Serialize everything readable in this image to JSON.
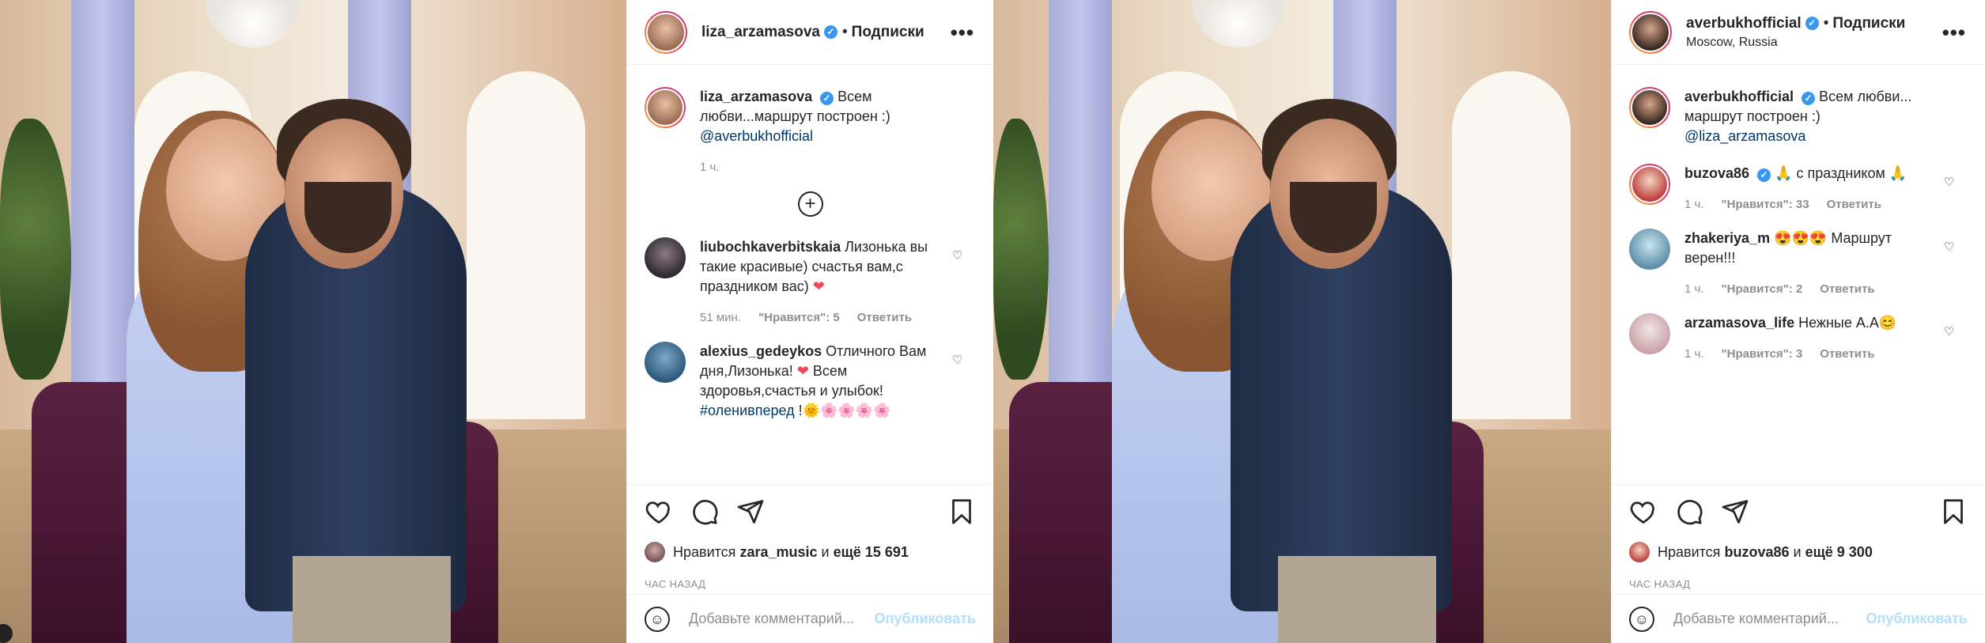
{
  "colors": {
    "verified": "#3897f0",
    "link": "#00376b",
    "muted": "#8e8e8e",
    "publish": "#b2dffc",
    "heart_red": "#ed4956"
  },
  "icons": {
    "verified": "verified-badge-icon",
    "more": "more-options-icon",
    "like": "heart-icon",
    "comment": "comment-icon",
    "share": "paper-plane-icon",
    "save": "bookmark-icon",
    "emoji": "emoji-icon",
    "load_more": "plus-circle-icon"
  },
  "post1": {
    "header": {
      "username": "liza_arzamasova",
      "dot": "•",
      "follow": "Подписки",
      "more": "•••"
    },
    "caption": {
      "username": "liza_arzamasova",
      "text": "Всем любви...маршрут построен :)",
      "mention": "@averbukhofficial",
      "time": "1 ч."
    },
    "comments": [
      {
        "username": "liubochkaverbitskaia",
        "text": "Лизонька вы такие красивые) счастья вам,с праздником вас)",
        "emoji": "❤",
        "time": "51 мин.",
        "likes": "\"Нравится\": 5",
        "reply": "Ответить"
      },
      {
        "username": "alexius_gedeykos",
        "text": "Отличного Вам дня,Лизонька!",
        "emoji": "❤",
        "text2": "Всем здоровья,счастья и улыбок!",
        "tag": "#оленивперед",
        "tail": "!🌞🌸🌸🌸🌸"
      }
    ],
    "likes": {
      "prefix": "Нравится",
      "user": "zara_music",
      "middle": "и",
      "count": "ещё 15 691"
    },
    "time": "ЧАС НАЗАД",
    "add_comment": {
      "placeholder": "Добавьте комментарий...",
      "publish": "Опубликовать"
    }
  },
  "post2": {
    "header": {
      "username": "averbukhofficial",
      "dot": "•",
      "follow": "Подписки",
      "location": "Moscow, Russia",
      "more": "•••"
    },
    "caption": {
      "username": "averbukhofficial",
      "text": "Всем любви... маршрут построен :)",
      "mention": "@liza_arzamasova"
    },
    "comments": [
      {
        "username": "buzova86",
        "text": "🙏 с праздником 🙏",
        "time": "1 ч.",
        "likes": "\"Нравится\": 33",
        "reply": "Ответить"
      },
      {
        "username": "zhakeriya_m",
        "text": "😍😍😍 Маршрут верен!!!",
        "time": "1 ч.",
        "likes": "\"Нравится\": 2",
        "reply": "Ответить"
      },
      {
        "username": "arzamasova_life",
        "text": "Нежные А.А😊",
        "time": "1 ч.",
        "likes": "\"Нравится\": 3",
        "reply": "Ответить"
      }
    ],
    "likes": {
      "prefix": "Нравится",
      "user": "buzova86",
      "middle": "и",
      "count": "ещё 9 300"
    },
    "time": "ЧАС НАЗАД",
    "add_comment": {
      "placeholder": "Добавьте комментарий...",
      "publish": "Опубликовать"
    }
  }
}
